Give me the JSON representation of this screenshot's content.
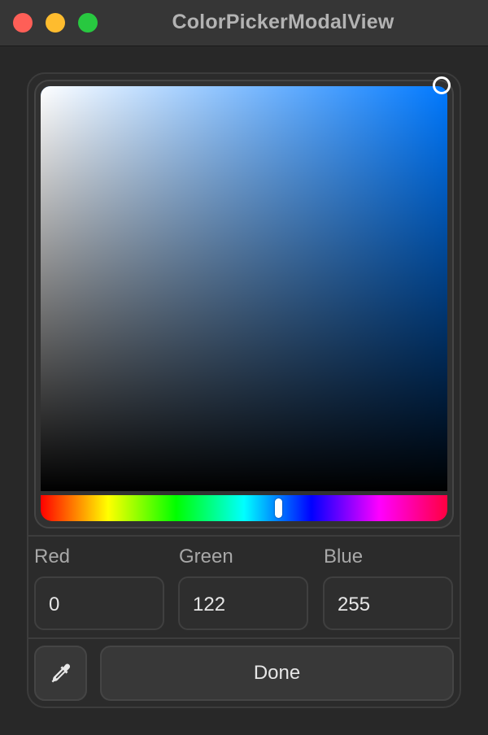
{
  "window": {
    "title": "ColorPickerModalView"
  },
  "colors": {
    "selected_hue": "#0079ff",
    "close": "#fe5f57",
    "minimize": "#febc2e",
    "maximize": "#28c840"
  },
  "picker": {
    "saturation": 1.0,
    "brightness": 1.0,
    "hue_degrees": 211
  },
  "fields": [
    {
      "label": "Red",
      "value": "0"
    },
    {
      "label": "Green",
      "value": "122"
    },
    {
      "label": "Blue",
      "value": "255"
    }
  ],
  "actions": {
    "eyedropper_icon": "eyedropper-icon",
    "done_label": "Done"
  }
}
